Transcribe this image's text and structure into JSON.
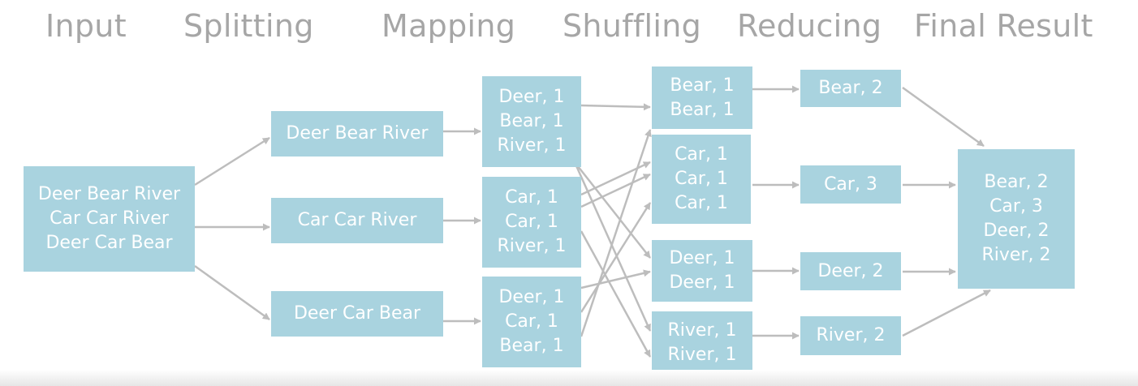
{
  "headers": {
    "input": "Input",
    "splitting": "Splitting",
    "mapping": "Mapping",
    "shuffling": "Shuffling",
    "reducing": "Reducing",
    "final": "Final Result"
  },
  "input": {
    "lines": [
      "Deer Bear River",
      "Car Car River",
      "Deer Car Bear"
    ]
  },
  "splits": [
    {
      "text": "Deer Bear River"
    },
    {
      "text": "Car Car River"
    },
    {
      "text": "Deer Car Bear"
    }
  ],
  "maps": [
    {
      "lines": [
        "Deer, 1",
        "Bear, 1",
        "River, 1"
      ]
    },
    {
      "lines": [
        "Car, 1",
        "Car, 1",
        "River, 1"
      ]
    },
    {
      "lines": [
        "Deer, 1",
        "Car, 1",
        "Bear, 1"
      ]
    }
  ],
  "shuffles": [
    {
      "lines": [
        "Bear, 1",
        "Bear, 1"
      ]
    },
    {
      "lines": [
        "Car, 1",
        "Car, 1",
        "Car, 1"
      ]
    },
    {
      "lines": [
        "Deer, 1",
        "Deer, 1"
      ]
    },
    {
      "lines": [
        "River, 1",
        "River, 1"
      ]
    }
  ],
  "reduces": [
    {
      "text": "Bear, 2"
    },
    {
      "text": "Car, 3"
    },
    {
      "text": "Deer, 2"
    },
    {
      "text": "River, 2"
    }
  ],
  "final": {
    "lines": [
      "Bear, 2",
      "Car, 3",
      "Deer, 2",
      "River, 2"
    ]
  },
  "colors": {
    "box": "#a9d3df",
    "box_text": "#ffffff",
    "arrow": "#bdbdbd",
    "header": "#a6a6a6"
  }
}
